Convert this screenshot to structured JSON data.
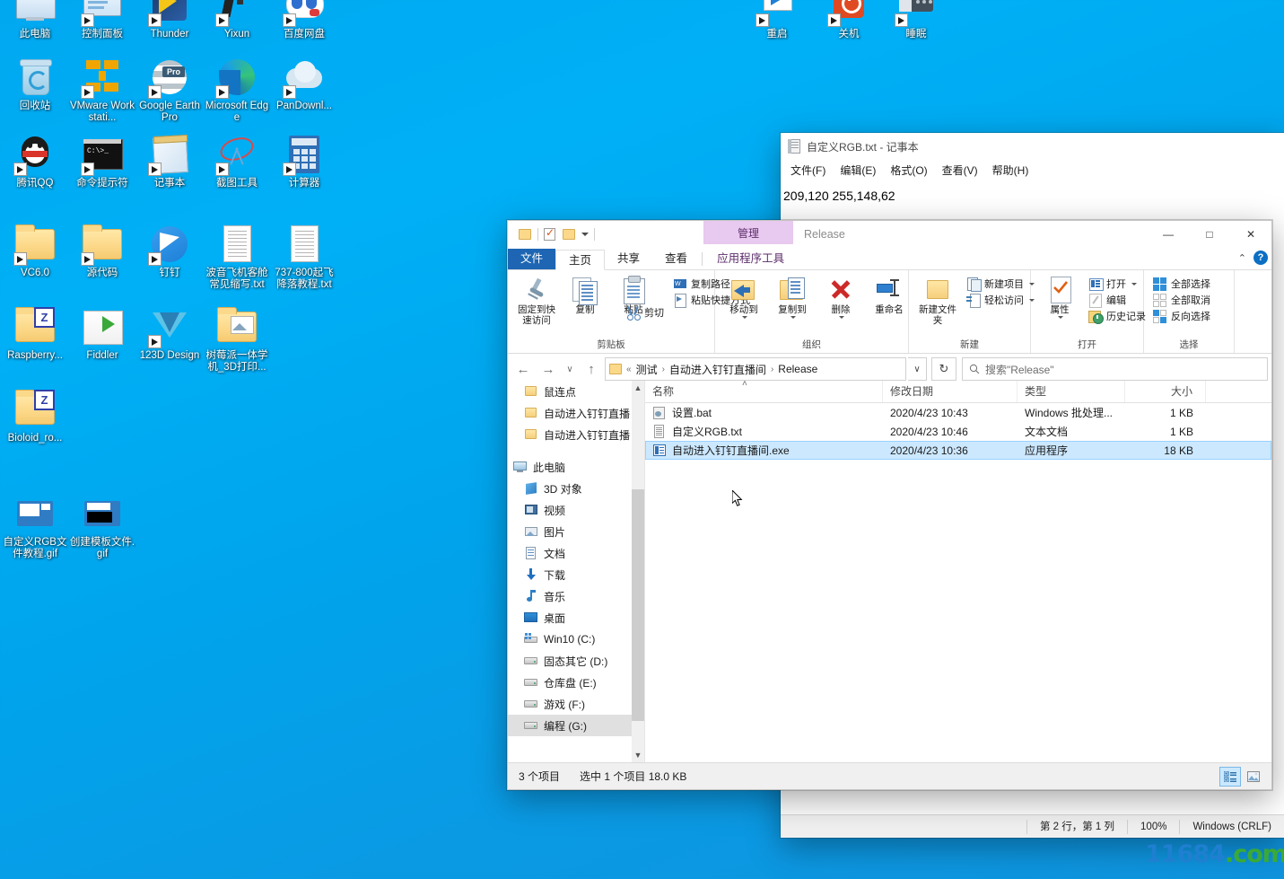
{
  "desktop": {
    "icons": [
      {
        "label": "此电脑",
        "art": "computer",
        "col": 0,
        "row": 0
      },
      {
        "label": "控制面板",
        "art": "control-panel",
        "col": 1,
        "row": 0
      },
      {
        "label": "Thunder",
        "art": "thunder",
        "col": 2,
        "row": 0
      },
      {
        "label": "Yixun",
        "art": "yixun",
        "col": 3,
        "row": 0
      },
      {
        "label": "百度网盘",
        "art": "baidu",
        "col": 4,
        "row": 0
      },
      {
        "label": "回收站",
        "art": "recycle-bin",
        "col": 0,
        "row": 1
      },
      {
        "label": "VMware Workstati...",
        "art": "vmware",
        "col": 1,
        "row": 1
      },
      {
        "label": "Google Earth Pro",
        "art": "google-earth",
        "col": 2,
        "row": 1
      },
      {
        "label": "Microsoft Edge",
        "art": "edge",
        "col": 3,
        "row": 1
      },
      {
        "label": "PanDownl...",
        "art": "pandownload",
        "col": 4,
        "row": 1
      },
      {
        "label": "腾讯QQ",
        "art": "qq",
        "col": 0,
        "row": 2
      },
      {
        "label": "命令提示符",
        "art": "cmd",
        "col": 1,
        "row": 2
      },
      {
        "label": "记事本",
        "art": "notepad",
        "col": 2,
        "row": 2
      },
      {
        "label": "截图工具",
        "art": "snip",
        "col": 3,
        "row": 2
      },
      {
        "label": "计算器",
        "art": "calculator",
        "col": 4,
        "row": 2
      },
      {
        "label": "VC6.0",
        "art": "folder",
        "col": 0,
        "row": 3
      },
      {
        "label": "源代码",
        "art": "folder",
        "col": 1,
        "row": 3
      },
      {
        "label": "钉钉",
        "art": "dingtalk",
        "col": 2,
        "row": 3
      },
      {
        "label": "波音飞机客舱常见缩写.txt",
        "art": "txt",
        "col": 3,
        "row": 3
      },
      {
        "label": "737-800起飞降落教程.txt",
        "art": "txt",
        "col": 4,
        "row": 3
      },
      {
        "label": "Raspberry...",
        "art": "folder-z",
        "col": 0,
        "row": 4
      },
      {
        "label": "Fiddler",
        "art": "folder-open",
        "col": 1,
        "row": 4
      },
      {
        "label": "123D Design",
        "art": "autodesk",
        "col": 2,
        "row": 4
      },
      {
        "label": "树莓派一体学机_3D打印...",
        "art": "folder-img",
        "col": 3,
        "row": 4
      },
      {
        "label": "Bioloid_ro...",
        "art": "folder-z",
        "col": 0,
        "row": 5
      },
      {
        "label": "自定义RGB文件教程.gif",
        "art": "gif",
        "col": 0,
        "row": 6
      },
      {
        "label": "创建模板文件.gif",
        "art": "gif2",
        "col": 1,
        "row": 6
      }
    ],
    "power_icons": [
      {
        "label": "重启",
        "art": "restart"
      },
      {
        "label": "关机",
        "art": "shutdown"
      },
      {
        "label": "睡眠",
        "art": "sleep"
      }
    ]
  },
  "notepad": {
    "title": "自定义RGB.txt - 记事本",
    "menu": [
      "文件(F)",
      "编辑(E)",
      "格式(O)",
      "查看(V)",
      "帮助(H)"
    ],
    "text": "209,120 255,148,62",
    "status": {
      "position": "第 2 行，第 1 列",
      "zoom": "100%",
      "encoding": "Windows (CRLF)"
    }
  },
  "explorer": {
    "window_name": "Release",
    "contextual_tab": "管理",
    "quick_access_tools": [
      "folder-icon",
      "checkbox-icon",
      "folder2-icon",
      "dropdown-icon"
    ],
    "window_buttons": {
      "minimize": "—",
      "maximize": "□",
      "close": "✕"
    },
    "ribbon_collapse": "⌃",
    "help": "?",
    "tabs": [
      {
        "label": "文件",
        "kind": "file"
      },
      {
        "label": "主页",
        "kind": "active"
      },
      {
        "label": "共享",
        "kind": "normal"
      },
      {
        "label": "查看",
        "kind": "normal"
      },
      {
        "label": "应用程序工具",
        "kind": "ctx"
      }
    ],
    "ribbon_groups": [
      {
        "title": "剪贴板",
        "big": [
          {
            "label": "固定到快速访问",
            "icon": "pin-icon"
          },
          {
            "label": "复制",
            "icon": "copy-icon"
          },
          {
            "label": "粘贴",
            "icon": "paste-icon"
          }
        ],
        "small_under_paste": [
          {
            "label": "剪切",
            "icon": "cut-icon"
          }
        ],
        "small": [
          {
            "label": "复制路径",
            "icon": "copy-path-icon"
          },
          {
            "label": "粘贴快捷方式",
            "icon": "paste-shortcut-icon"
          }
        ]
      },
      {
        "title": "组织",
        "big": [
          {
            "label": "移动到",
            "icon": "move-to-icon",
            "caret": true
          },
          {
            "label": "复制到",
            "icon": "copy-to-icon",
            "caret": true
          },
          {
            "label": "删除",
            "icon": "delete-icon",
            "caret": true
          },
          {
            "label": "重命名",
            "icon": "rename-icon",
            "caret": false
          }
        ],
        "small": []
      },
      {
        "title": "新建",
        "big": [
          {
            "label": "新建文件夹",
            "icon": "new-folder-icon"
          }
        ],
        "small": [
          {
            "label": "新建项目",
            "icon": "new-item-icon",
            "caret": true
          },
          {
            "label": "轻松访问",
            "icon": "easy-access-icon",
            "caret": true
          }
        ]
      },
      {
        "title": "打开",
        "big": [
          {
            "label": "属性",
            "icon": "properties-icon",
            "caret": true
          }
        ],
        "small": [
          {
            "label": "打开",
            "icon": "open-icon",
            "caret": true
          },
          {
            "label": "编辑",
            "icon": "edit-icon"
          },
          {
            "label": "历史记录",
            "icon": "history-icon"
          }
        ]
      },
      {
        "title": "选择",
        "big": [],
        "small": [
          {
            "label": "全部选择",
            "icon": "select-all-icon"
          },
          {
            "label": "全部取消",
            "icon": "select-none-icon"
          },
          {
            "label": "反向选择",
            "icon": "invert-selection-icon"
          }
        ]
      }
    ],
    "address": {
      "back": "←",
      "forward": "→",
      "recent": "∨",
      "up": "↑",
      "prefix": "«",
      "crumbs": [
        "测试",
        "自动进入钉钉直播间",
        "Release"
      ],
      "dropdown": "∨",
      "refresh": "↻"
    },
    "search": {
      "placeholder": "搜索\"Release\"",
      "icon": "search-icon"
    },
    "nav_items": [
      {
        "label": "鼠连点",
        "icon": "folder-icon",
        "indent": 1,
        "selected": false
      },
      {
        "label": "自动进入钉钉直播",
        "icon": "folder-icon",
        "indent": 1,
        "selected": false
      },
      {
        "label": "自动进入钉钉直播",
        "icon": "folder-icon",
        "indent": 1,
        "selected": false
      },
      {
        "label": "此电脑",
        "icon": "computer-icon",
        "indent": 0,
        "selected": false
      },
      {
        "label": "3D 对象",
        "icon": "3d-objects-icon",
        "indent": 1,
        "selected": false
      },
      {
        "label": "视频",
        "icon": "videos-icon",
        "indent": 1,
        "selected": false
      },
      {
        "label": "图片",
        "icon": "pictures-icon",
        "indent": 1,
        "selected": false
      },
      {
        "label": "文档",
        "icon": "documents-icon",
        "indent": 1,
        "selected": false
      },
      {
        "label": "下载",
        "icon": "downloads-icon",
        "indent": 1,
        "selected": false
      },
      {
        "label": "音乐",
        "icon": "music-icon",
        "indent": 1,
        "selected": false
      },
      {
        "label": "桌面",
        "icon": "desktop-icon",
        "indent": 1,
        "selected": false
      },
      {
        "label": "Win10 (C:)",
        "icon": "os-drive-icon",
        "indent": 1,
        "selected": false
      },
      {
        "label": "固态其它 (D:)",
        "icon": "drive-icon",
        "indent": 1,
        "selected": false
      },
      {
        "label": "仓库盘 (E:)",
        "icon": "drive-icon",
        "indent": 1,
        "selected": false
      },
      {
        "label": "游戏 (F:)",
        "icon": "drive-icon",
        "indent": 1,
        "selected": false
      },
      {
        "label": "编程 (G:)",
        "icon": "drive-icon",
        "indent": 1,
        "selected": true
      }
    ],
    "columns": [
      "名称",
      "修改日期",
      "类型",
      "大小"
    ],
    "sort_indicator": "˄",
    "files": [
      {
        "name": "设置.bat",
        "date": "2020/4/23 10:43",
        "type": "Windows 批处理...",
        "size": "1 KB",
        "icon": "bat-icon",
        "selected": false
      },
      {
        "name": "自定义RGB.txt",
        "date": "2020/4/23 10:46",
        "type": "文本文档",
        "size": "1 KB",
        "icon": "txt-icon",
        "selected": false
      },
      {
        "name": "自动进入钉钉直播间.exe",
        "date": "2020/4/23 10:36",
        "type": "应用程序",
        "size": "18 KB",
        "icon": "exe-icon",
        "selected": true
      }
    ],
    "status": {
      "count": "3 个项目",
      "selection": "选中 1 个项目  18.0 KB"
    },
    "view_buttons": [
      {
        "name": "details-view",
        "active": true
      },
      {
        "name": "large-icons-view",
        "active": false
      }
    ]
  },
  "watermark": {
    "blue": "11684",
    "green": ".com"
  },
  "colors": {
    "accent": "#0b6fc4",
    "selection": "#cce8ff",
    "desktop": "#00a8f0",
    "ctx_tab": "#e8c9ef"
  }
}
